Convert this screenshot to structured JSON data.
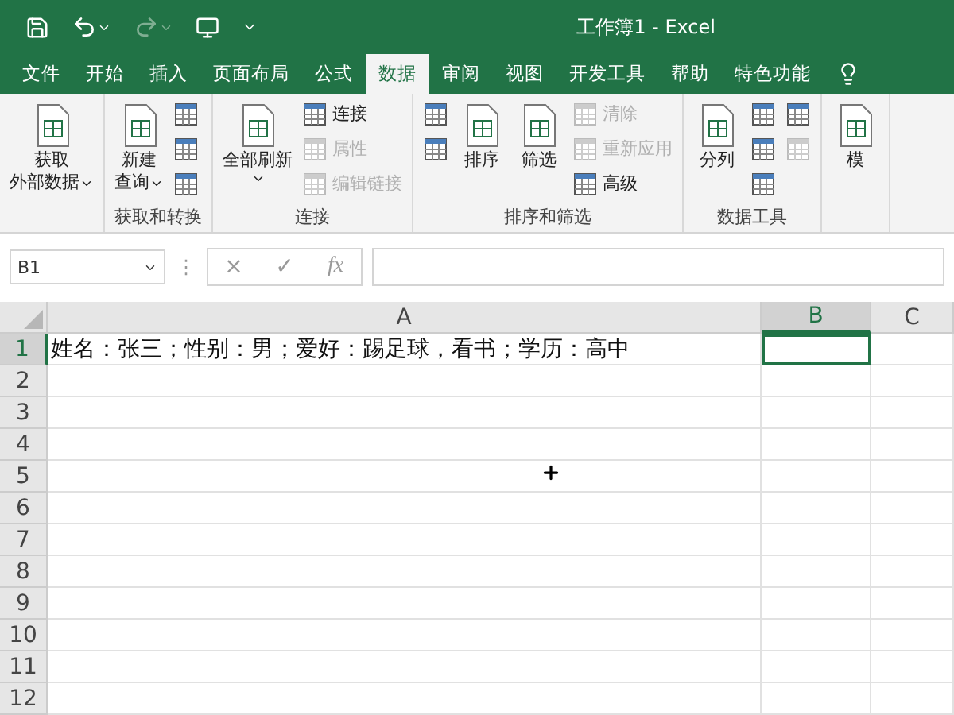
{
  "window": {
    "title": "工作簿1 - Excel"
  },
  "quick_access": [
    {
      "kind": "save",
      "disabled": false
    },
    {
      "kind": "undo",
      "disabled": false
    },
    {
      "kind": "redo",
      "disabled": true
    },
    {
      "kind": "touch",
      "disabled": false
    },
    {
      "kind": "customize",
      "disabled": false
    }
  ],
  "tabs": [
    {
      "label": "文件",
      "selected": false
    },
    {
      "label": "开始",
      "selected": false
    },
    {
      "label": "插入",
      "selected": false
    },
    {
      "label": "页面布局",
      "selected": false
    },
    {
      "label": "公式",
      "selected": false
    },
    {
      "label": "数据",
      "selected": true
    },
    {
      "label": "审阅",
      "selected": false
    },
    {
      "label": "视图",
      "selected": false
    },
    {
      "label": "开发工具",
      "selected": false
    },
    {
      "label": "帮助",
      "selected": false
    },
    {
      "label": "特色功能",
      "selected": false
    }
  ],
  "ribbon_groups": [
    {
      "columns": [
        [
          {
            "kind": "large",
            "lines": [
              "获取",
              "外部数据"
            ],
            "dropdown": true,
            "disabled": false
          }
        ]
      ]
    },
    {
      "label": "获取和转换",
      "columns": [
        [
          {
            "kind": "large",
            "lines": [
              "新建",
              "查询"
            ],
            "dropdown": true,
            "disabled": false
          }
        ],
        [
          {
            "kind": "icon",
            "disabled": false
          },
          {
            "kind": "icon",
            "disabled": false
          },
          {
            "kind": "icon",
            "disabled": false
          }
        ]
      ]
    },
    {
      "label": "连接",
      "columns": [
        [
          {
            "kind": "large",
            "lines": [
              "全部刷新"
            ],
            "dropdown": true,
            "disabled": false
          }
        ],
        [
          {
            "kind": "small",
            "label": "连接",
            "disabled": false
          },
          {
            "kind": "small",
            "label": "属性",
            "disabled": true
          },
          {
            "kind": "small",
            "label": "编辑链接",
            "disabled": true
          }
        ]
      ]
    },
    {
      "label": "排序和筛选",
      "columns": [
        [
          {
            "kind": "icon",
            "disabled": false
          },
          {
            "kind": "icon",
            "disabled": false
          }
        ],
        [
          {
            "kind": "large",
            "lines": [
              "排序"
            ],
            "dropdown": false,
            "disabled": false
          }
        ],
        [
          {
            "kind": "large",
            "lines": [
              "筛选"
            ],
            "dropdown": false,
            "disabled": false
          }
        ],
        [
          {
            "kind": "small",
            "label": "清除",
            "disabled": true
          },
          {
            "kind": "small",
            "label": "重新应用",
            "disabled": true
          },
          {
            "kind": "small",
            "label": "高级",
            "disabled": false
          }
        ]
      ]
    },
    {
      "label": "数据工具",
      "columns": [
        [
          {
            "kind": "large",
            "lines": [
              "分列"
            ],
            "dropdown": false,
            "disabled": false
          }
        ],
        [
          {
            "kind": "icon",
            "disabled": false
          },
          {
            "kind": "icon",
            "disabled": false
          },
          {
            "kind": "icon",
            "disabled": false
          }
        ],
        [
          {
            "kind": "icon",
            "disabled": false
          },
          {
            "kind": "icon",
            "disabled": true
          }
        ]
      ]
    },
    {
      "columns": [
        [
          {
            "kind": "large",
            "lines": [
              "模"
            ],
            "dropdown": false,
            "disabled": false
          }
        ]
      ]
    }
  ],
  "name_box": {
    "value": "B1"
  },
  "formula_handle": "⋮",
  "formula_buttons": [
    "×",
    "✓",
    "fx"
  ],
  "columns": [
    {
      "label": "A",
      "selected": false
    },
    {
      "label": "B",
      "selected": true
    },
    {
      "label": "C",
      "selected": false
    }
  ],
  "rows": [
    {
      "number": "1",
      "selected": true,
      "text": "姓名：张三；性别：男；爱好：踢足球，看书；学历：高中"
    },
    {
      "number": "2",
      "selected": false
    },
    {
      "number": "3",
      "selected": false
    },
    {
      "number": "4",
      "selected": false
    },
    {
      "number": "5",
      "selected": false
    },
    {
      "number": "6",
      "selected": false
    },
    {
      "number": "7",
      "selected": false
    },
    {
      "number": "8",
      "selected": false
    },
    {
      "number": "9",
      "selected": false
    },
    {
      "number": "10",
      "selected": false
    },
    {
      "number": "11",
      "selected": false
    },
    {
      "number": "12",
      "selected": false
    }
  ]
}
